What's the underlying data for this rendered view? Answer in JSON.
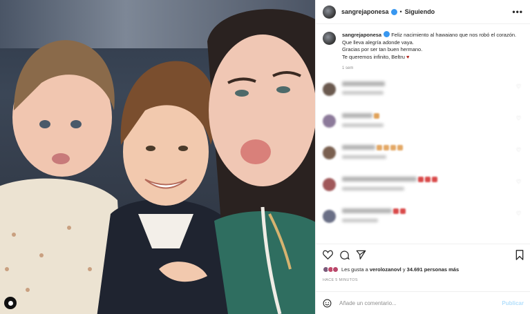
{
  "post": {
    "username": "sangrejaponesa",
    "follow_dot": "•",
    "follow_state": "Siguiendo",
    "more": "•••",
    "caption_user": "sangrejaponesa",
    "caption_line1": "Feliz nacimiento al hawaiano que nos robó el corazón. Que lleva alegría adonde vaya.",
    "caption_line2": "Gracias por ser tan buen hermano.",
    "caption_line3": "Te queremos infinito, Beltru",
    "caption_heart": "♥",
    "caption_time": "1 sem"
  },
  "comments_meta": {
    "count_visible": 5
  },
  "likes": {
    "prefix": "Les gusta a",
    "user": "verolozanovl",
    "middle": "y",
    "count": "34.691 personas más"
  },
  "time_ago": "HACE 5 MINUTOS",
  "add_comment": {
    "placeholder": "Añade un comentario...",
    "post_label": "Publicar"
  },
  "colors": {
    "accent_blue": "#3897f0",
    "heart_red": "#b3261e",
    "publish_disabled": "#b2dffc"
  },
  "icons": [
    "tag-icon",
    "verified-icon",
    "more-icon",
    "like-icon",
    "comment-icon",
    "share-icon",
    "save-icon",
    "emoji-icon"
  ]
}
